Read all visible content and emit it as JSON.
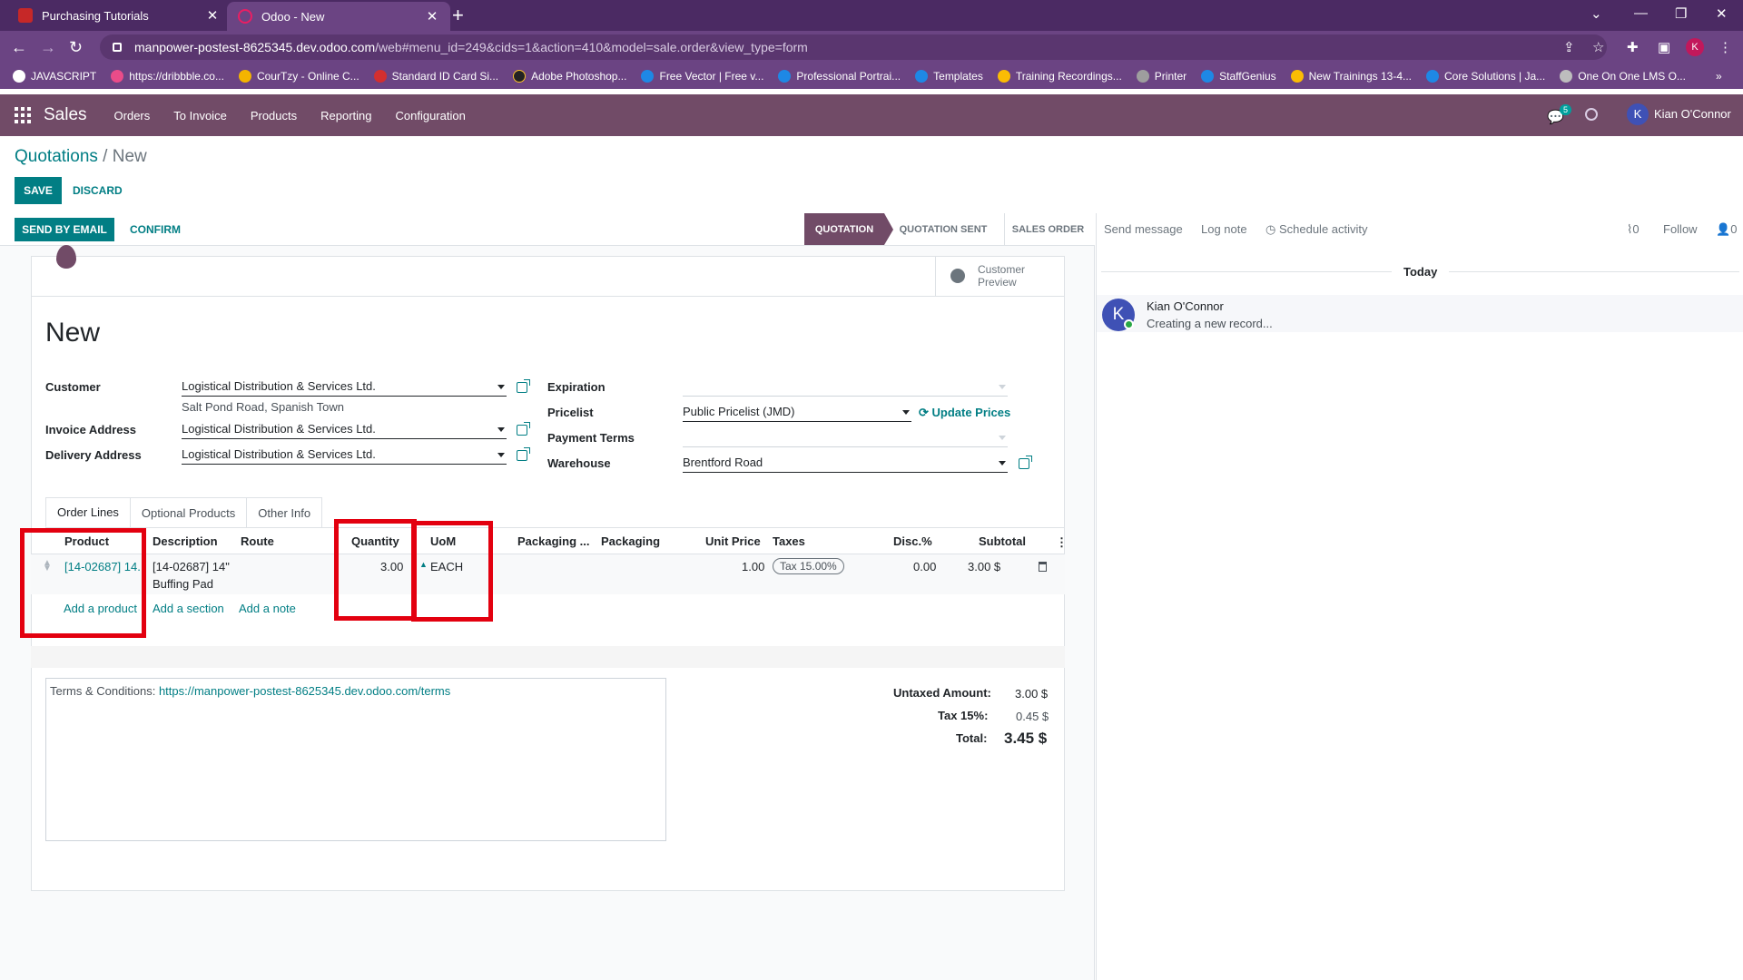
{
  "browser": {
    "tabs": [
      {
        "title": "Purchasing Tutorials",
        "close": "✕"
      },
      {
        "title": "Odoo - New",
        "close": "✕"
      }
    ],
    "new_tab": "+",
    "url_host": "manpower-postest-8625345.dev.odoo.com",
    "url_path": "/web#menu_id=249&cids=1&action=410&model=sale.order&view_type=form",
    "profile_initial": "K",
    "bookmarks": [
      {
        "label": "JAVASCRIPT",
        "color": "#ffffff"
      },
      {
        "label": "https://dribbble.co...",
        "color": "#ea4c89"
      },
      {
        "label": "CourTzy - Online C...",
        "color": "#f4b400"
      },
      {
        "label": "Standard ID Card Si...",
        "color": "#d32f2f"
      },
      {
        "label": "Adobe Photoshop...",
        "color": "#222222"
      },
      {
        "label": "Free Vector | Free v...",
        "color": "#1e88e5"
      },
      {
        "label": "Professional Portrai...",
        "color": "#1e88e5"
      },
      {
        "label": "Templates",
        "color": "#1e88e5"
      },
      {
        "label": "Training Recordings...",
        "color": "#fbbc04"
      },
      {
        "label": "Printer",
        "color": "#9e9e9e"
      },
      {
        "label": "StaffGenius",
        "color": "#1e88e5"
      },
      {
        "label": "New Trainings 13-4...",
        "color": "#fbbc04"
      },
      {
        "label": "Core Solutions | Ja...",
        "color": "#1e88e5"
      },
      {
        "label": "One On One LMS O...",
        "color": "#bdbdbd"
      }
    ],
    "more": "»"
  },
  "app": {
    "brand": "Sales",
    "menu": [
      "Orders",
      "To Invoice",
      "Products",
      "Reporting",
      "Configuration"
    ],
    "messages_count": "5",
    "user_initial": "K",
    "user_name": "Kian O'Connor"
  },
  "control": {
    "breadcrumb_parent": "Quotations",
    "breadcrumb_sep": " / ",
    "breadcrumb_current": "New",
    "save": "SAVE",
    "discard": "DISCARD"
  },
  "statusbar": {
    "send_email": "SEND BY EMAIL",
    "confirm": "CONFIRM",
    "stages": [
      "QUOTATION",
      "QUOTATION SENT",
      "SALES ORDER"
    ],
    "active_stage": "QUOTATION"
  },
  "form": {
    "preview_line1": "Customer",
    "preview_line2": "Preview",
    "title": "New",
    "customer_label": "Customer",
    "customer_value": "Logistical Distribution & Services Ltd.",
    "customer_address": "Salt Pond Road, Spanish Town",
    "invoice_label": "Invoice Address",
    "invoice_value": "Logistical Distribution & Services Ltd.",
    "delivery_label": "Delivery Address",
    "delivery_value": "Logistical Distribution & Services Ltd.",
    "expiration_label": "Expiration",
    "expiration_value": "",
    "pricelist_label": "Pricelist",
    "pricelist_value": "Public Pricelist (JMD)",
    "update_prices": "Update Prices",
    "payment_terms_label": "Payment Terms",
    "payment_terms_value": "",
    "warehouse_label": "Warehouse",
    "warehouse_value": "Brentford Road"
  },
  "notebook": {
    "tabs": [
      "Order Lines",
      "Optional Products",
      "Other Info"
    ],
    "active_tab": "Order Lines"
  },
  "order_lines": {
    "columns": [
      "Product",
      "Description",
      "Route",
      "Quantity",
      "UoM",
      "Packaging ...",
      "Packaging",
      "Unit Price",
      "Taxes",
      "Disc.%",
      "Subtotal"
    ],
    "rows": [
      {
        "product": "[14-02687] 14.",
        "description_line1": "[14-02687] 14\"",
        "description_line2": "Buffing Pad",
        "route": "",
        "quantity": "3.00",
        "uom": "EACH",
        "packaging_qty": "",
        "packaging": "",
        "unit_price": "1.00",
        "taxes": "Tax 15.00%",
        "discount": "0.00",
        "subtotal": "3.00 $"
      }
    ],
    "add_product": "Add a product",
    "add_section": "Add a section",
    "add_note": "Add a note",
    "optional_columns_icon": "⋮"
  },
  "terms": {
    "label": "Terms & Conditions: ",
    "link": "https://manpower-postest-8625345.dev.odoo.com/terms"
  },
  "totals": {
    "untaxed_label": "Untaxed Amount:",
    "untaxed_value": "3.00 $",
    "tax_label": "Tax 15%:",
    "tax_value": "0.45 $",
    "total_label": "Total:",
    "total_value": "3.45 $"
  },
  "chatter": {
    "send_message": "Send message",
    "log_note": "Log note",
    "schedule_activity": "Schedule activity",
    "attachments_count": "0",
    "follow": "Follow",
    "followers_count": "0",
    "today": "Today",
    "author": "Kian O'Connor",
    "author_initial": "K",
    "message": "Creating a new record..."
  },
  "colors": {
    "brand": "#714b67",
    "primary": "#017e84",
    "highlight": "#e3000f"
  }
}
